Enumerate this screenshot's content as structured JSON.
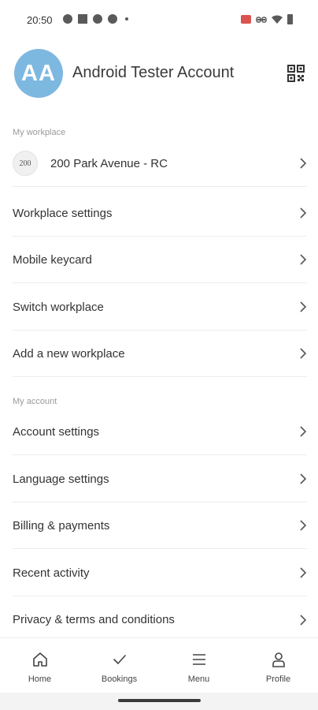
{
  "status_bar": {
    "time": "20:50"
  },
  "profile": {
    "initials": "AA",
    "name": "Android Tester Account",
    "avatar_color": "#7db8e0"
  },
  "sections": {
    "workplace_label": "My workplace",
    "account_label": "My account"
  },
  "workplace": {
    "logo_text": "200",
    "name": "200 Park Avenue - RC"
  },
  "workplace_items": [
    {
      "label": "Workplace settings"
    },
    {
      "label": "Mobile keycard"
    },
    {
      "label": "Switch workplace"
    },
    {
      "label": "Add a new workplace"
    }
  ],
  "account_items": [
    {
      "label": "Account settings"
    },
    {
      "label": "Language settings"
    },
    {
      "label": "Billing & payments"
    },
    {
      "label": "Recent activity"
    },
    {
      "label": "Privacy & terms and conditions"
    }
  ],
  "bottom_nav": [
    {
      "label": "Home",
      "icon": "home-icon"
    },
    {
      "label": "Bookings",
      "icon": "check-icon"
    },
    {
      "label": "Menu",
      "icon": "menu-icon"
    },
    {
      "label": "Profile",
      "icon": "profile-icon"
    }
  ]
}
